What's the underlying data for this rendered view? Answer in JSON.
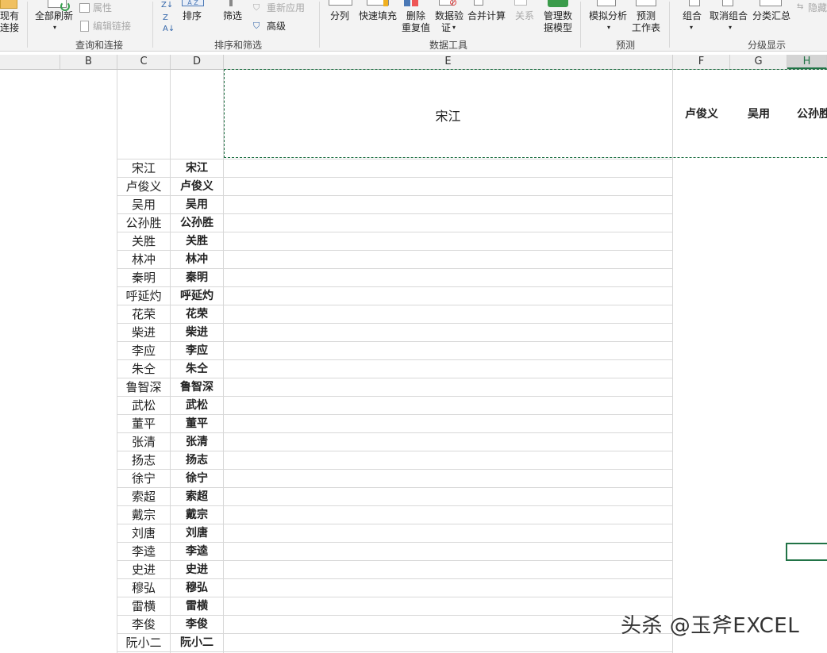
{
  "ribbon": {
    "conn_top": "现有",
    "conn_bottom": "连接",
    "refresh_all": "全部刷新",
    "properties": "属性",
    "edit_links": "编辑链接",
    "group_query": "查询和连接",
    "sort": "排序",
    "filter": "筛选",
    "reapply": "重新应用",
    "advanced": "高级",
    "group_sort_filter": "排序和筛选",
    "text_to_columns": "分列",
    "flash_fill": "快速填充",
    "remove_dup_1": "删除",
    "remove_dup_2": "重复值",
    "validation_1": "数据验",
    "validation_2": "证",
    "consolidate": "合并计算",
    "relations": "关系",
    "manage_model_1": "管理数",
    "manage_model_2": "据模型",
    "group_data_tools": "数据工具",
    "what_if": "模拟分析",
    "forecast_1": "预测",
    "forecast_2": "工作表",
    "group_forecast": "预测",
    "group_btn": "组合",
    "ungroup_btn": "取消组合",
    "subtotal": "分类汇总",
    "hide_detail": "隐藏",
    "group_outline": "分级显示",
    "sort_az": "A Z"
  },
  "columns": {
    "b": "B",
    "c": "C",
    "d": "D",
    "e": "E",
    "f": "F",
    "g": "G",
    "h": "H"
  },
  "header_row": {
    "e": "宋江",
    "f": "卢俊义",
    "g": "吴用",
    "h": "公孙胜"
  },
  "names": [
    "宋江",
    "卢俊义",
    "吴用",
    "公孙胜",
    "关胜",
    "林冲",
    "秦明",
    "呼延灼",
    "花荣",
    "柴进",
    "李应",
    "朱仝",
    "鲁智深",
    "武松",
    "董平",
    "张清",
    "扬志",
    "徐宁",
    "索超",
    "戴宗",
    "刘唐",
    "李逵",
    "史进",
    "穆弘",
    "雷横",
    "李俊",
    "阮小二"
  ],
  "watermark": "头杀 @玉斧EXCEL",
  "colors": {
    "accent": "#217346",
    "ribbon_bg": "#f3f3f3",
    "grid": "#d8d8d8"
  }
}
